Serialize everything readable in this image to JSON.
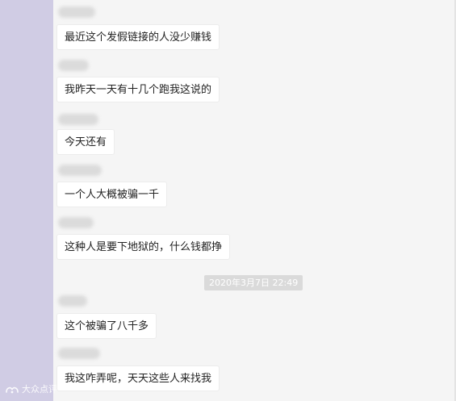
{
  "messages": [
    "最近这个发假链接的人没少赚钱",
    "我昨天一天有十几个跑我这说的",
    "今天还有",
    "一个人大概被骗一千",
    "这种人是要下地狱的，什么钱都挣",
    "这个被骗了八千多",
    "我这咋弄呢，天天这些人来找我"
  ],
  "timestamp": "2020年3月7日 22:49",
  "watermark": "大众点评",
  "colors": {
    "background": "#f5f5f5",
    "bubble": "#ffffff",
    "avatar_strip": "#d0cce4",
    "timestamp_bg": "#dadada"
  }
}
